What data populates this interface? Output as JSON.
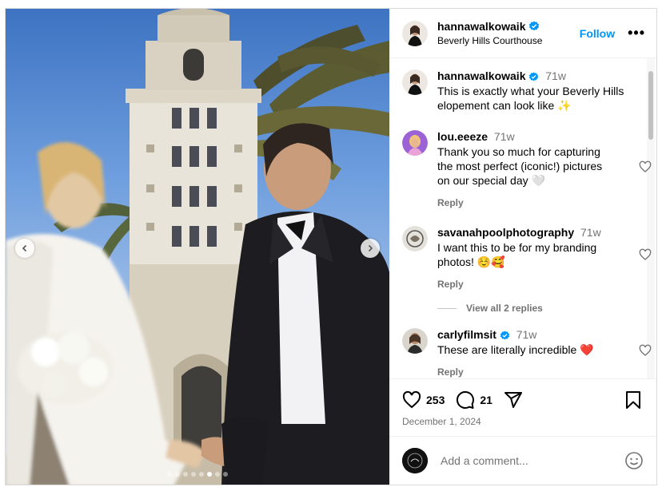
{
  "post": {
    "author": "hannawalkowaik",
    "location": "Beverly Hills Courthouse",
    "follow_label": "Follow",
    "more_label": "•••",
    "caption": {
      "username": "hannawalkowaik",
      "time": "71w",
      "text": "This is exactly what your Beverly Hills elopement can look like ✨"
    }
  },
  "comments": [
    {
      "username": "lou.eeeze",
      "time": "71w",
      "text": "Thank you so much for capturing the most perfect (iconic!) pictures on our special day 🤍",
      "reply_label": "Reply"
    },
    {
      "username": "savanahpoolphotography",
      "time": "71w",
      "text": "I want this to be for my branding photos! ☺️🥰",
      "reply_label": "Reply",
      "view_replies": "View all 2 replies"
    },
    {
      "username": "carlyfilmsit",
      "time": "71w",
      "text": "These are literally incredible ❤️",
      "reply_label": "Reply"
    }
  ],
  "stats": {
    "likes": "253",
    "comments": "21",
    "date": "December 1, 2024"
  },
  "composer": {
    "placeholder": "Add a comment..."
  },
  "carousel": {
    "slide_count": 8,
    "active_index": 5
  },
  "colors": {
    "accent": "#0095f6",
    "muted": "#737373",
    "verified": "#0095f6",
    "border": "#dbdbdb"
  },
  "icons": [
    "verified-icon",
    "heart-icon",
    "comment-icon",
    "share-icon",
    "bookmark-icon",
    "emoji-icon",
    "chevron-left-icon",
    "chevron-right-icon"
  ]
}
